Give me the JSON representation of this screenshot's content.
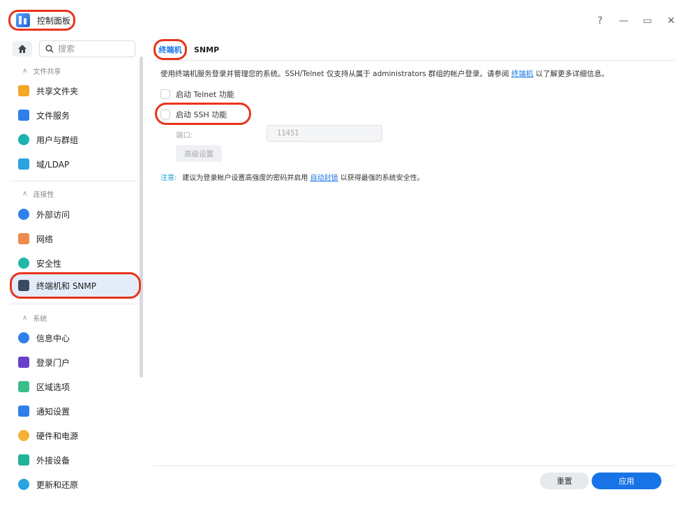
{
  "window": {
    "title": "控制面板",
    "controls": [
      "?",
      "—",
      "▭",
      "✕"
    ]
  },
  "sidebar": {
    "search_placeholder": "搜索",
    "sections": [
      {
        "title": "文件共享",
        "items": [
          "共享文件夹",
          "文件服务",
          "用户与群组",
          "域/LDAP"
        ]
      },
      {
        "title": "连接性",
        "items": [
          "外部访问",
          "网络",
          "安全性",
          "终端机和 SNMP"
        ]
      },
      {
        "title": "系统",
        "items": [
          "信息中心",
          "登录门户",
          "区域选项",
          "通知设置",
          "硬件和电源",
          "外接设备",
          "更新和还原"
        ]
      }
    ],
    "active_item": "终端机和 SNMP"
  },
  "main": {
    "tabs": [
      "终端机",
      "SNMP"
    ],
    "active_tab": "终端机",
    "description_prefix": "使用终端机服务登录并管理您的系统。SSH/Telnet 仅支持从属于 administrators 群组的帐户登录。请参阅 ",
    "description_link": "终端机",
    "description_suffix": " 以了解更多详细信息。",
    "telnet_label": "启动 Telnet 功能",
    "ssh_label": "启动 SSH 功能",
    "port_label": "端口:",
    "port_value": "11451",
    "advanced_button": "高级设置",
    "note_label": "注意:",
    "note_prefix": "建议为登录帐户设置高强度的密码并启用 ",
    "note_link": "自动封锁",
    "note_suffix": " 以获得最强的系统安全性。",
    "reset_button": "重置",
    "apply_button": "应用"
  },
  "colors": {
    "accent": "#1874e6",
    "highlight_ring": "#e8341c"
  }
}
